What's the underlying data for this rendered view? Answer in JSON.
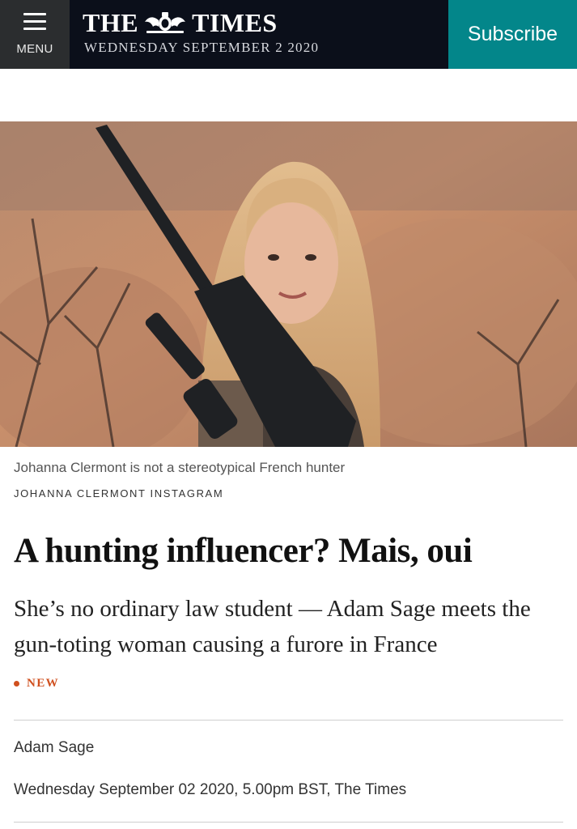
{
  "header": {
    "menu_label": "MENU",
    "logo_left": "THE",
    "logo_right": "TIMES",
    "date_line": "WEDNESDAY SEPTEMBER 2 2020",
    "subscribe_label": "Subscribe",
    "colors": {
      "bar": "#0b0f1a",
      "menu": "#2b2d2f",
      "subscribe": "#03868a"
    }
  },
  "article": {
    "image_caption": "Johanna Clermont is not a stereotypical French hunter",
    "image_credit": "JOHANNA CLERMONT INSTAGRAM",
    "headline": "A hunting influencer? Mais, oui",
    "standfirst": "She’s no ordinary law student — Adam Sage meets the gun-toting woman causing a furore in France",
    "badge": "NEW",
    "author": "Adam Sage",
    "published": "Wednesday September 02 2020, 5.00pm BST, The Times",
    "accent_color": "#d0501f"
  }
}
